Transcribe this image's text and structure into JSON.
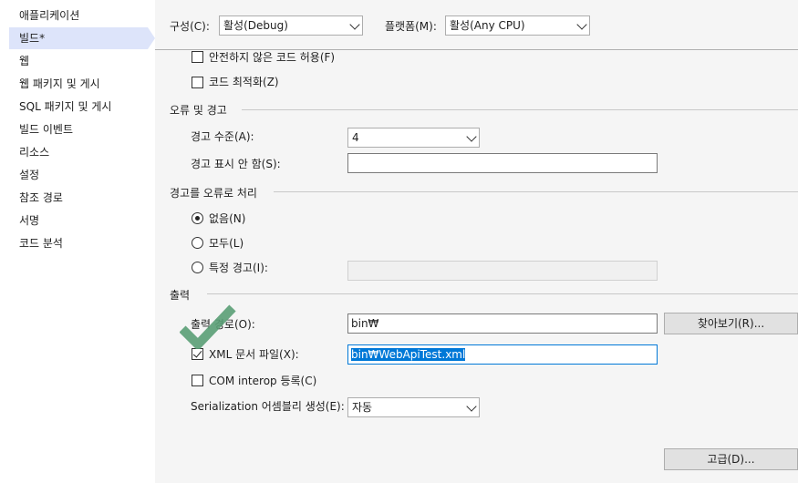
{
  "sidebar": {
    "items": [
      {
        "label": "애플리케이션"
      },
      {
        "label": "빌드*"
      },
      {
        "label": "웹"
      },
      {
        "label": "웹 패키지 및 게시"
      },
      {
        "label": "SQL 패키지 및 게시"
      },
      {
        "label": "빌드 이벤트"
      },
      {
        "label": "리소스"
      },
      {
        "label": "설정"
      },
      {
        "label": "참조 경로"
      },
      {
        "label": "서명"
      },
      {
        "label": "코드 분석"
      }
    ],
    "active_index": 1
  },
  "header": {
    "config_label": "구성(C):",
    "config_value": "활성(Debug)",
    "platform_label": "플랫폼(M):",
    "platform_value": "활성(Any CPU)"
  },
  "general": {
    "unsafe_label": "안전하지 않은 코드 허용(F)",
    "optimize_label": "코드 최적화(Z)"
  },
  "errors": {
    "title": "오류 및 경고",
    "warning_level_label": "경고 수준(A):",
    "warning_level_value": "4",
    "suppress_label": "경고 표시 안 함(S):",
    "suppress_value": ""
  },
  "treat_warnings": {
    "title": "경고를 오류로 처리",
    "none_label": "없음(N)",
    "all_label": "모두(L)",
    "specific_label": "특정 경고(I):",
    "specific_value": ""
  },
  "output": {
    "title": "출력",
    "path_label": "출력 경로(O):",
    "path_value": "bin₩",
    "browse_label": "찾아보기(R)...",
    "xml_label": "XML 문서 파일(X):",
    "xml_value": "bin₩WebApiTest.xml",
    "com_label": "COM interop 등록(C)",
    "serialization_label": "Serialization 어셈블리 생성(E):",
    "serialization_value": "자동"
  },
  "footer": {
    "advanced_label": "고급(D)..."
  },
  "colors": {
    "accent": "#0078d7",
    "sidebar_active": "#dde4fa",
    "checkmark_overlay": "#5a9e76"
  }
}
